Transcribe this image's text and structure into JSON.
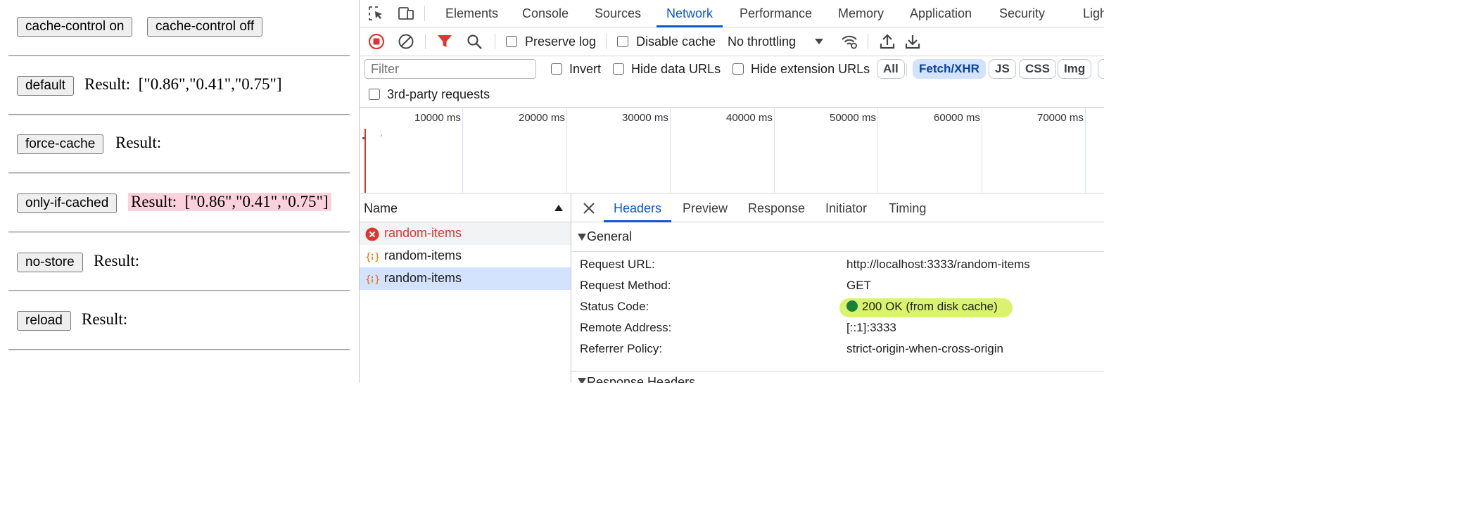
{
  "page": {
    "buttons": {
      "cache_on": "cache-control on",
      "cache_off": "cache-control off",
      "default": "default",
      "force_cache": "force-cache",
      "only_if_cached": "only-if-cached",
      "no_store": "no-store",
      "reload": "reload"
    },
    "result_label": "Result:",
    "results": {
      "default": "[\"0.86\",\"0.41\",\"0.75\"]",
      "force_cache": "",
      "only_if_cached": "[\"0.86\",\"0.41\",\"0.75\"]",
      "no_store": "",
      "reload": ""
    },
    "highlight_color": "#fbd1de"
  },
  "devtools": {
    "tabs": [
      "Elements",
      "Console",
      "Sources",
      "Network",
      "Performance",
      "Memory",
      "Application",
      "Security",
      "Ligh"
    ],
    "active_tab": "Network",
    "toolbar": {
      "preserve_log": "Preserve log",
      "disable_cache": "Disable cache",
      "throttling": "No throttling",
      "icons": [
        "record-stop-icon",
        "clear-icon",
        "filter-icon",
        "search-icon",
        "network-conditions-icon",
        "import-har-icon",
        "export-har-icon"
      ]
    },
    "filter": {
      "placeholder": "Filter",
      "invert": "Invert",
      "hide_data_urls": "Hide data URLs",
      "hide_extension_urls": "Hide extension URLs",
      "third_party": "3rd-party requests",
      "types": [
        "All",
        "Fetch/XHR",
        "JS",
        "CSS",
        "Img"
      ],
      "active_type": "Fetch/XHR"
    },
    "timeline": {
      "labels": [
        "10000 ms",
        "20000 ms",
        "30000 ms",
        "40000 ms",
        "50000 ms",
        "60000 ms",
        "70000 ms"
      ]
    },
    "requests": {
      "header": "Name",
      "rows": [
        {
          "name": "random-items",
          "status": "error"
        },
        {
          "name": "random-items",
          "status": "fetch"
        },
        {
          "name": "random-items",
          "status": "fetch",
          "selected": true
        }
      ]
    },
    "details": {
      "tabs": [
        "Headers",
        "Preview",
        "Response",
        "Initiator",
        "Timing"
      ],
      "active_tab": "Headers",
      "section": "General",
      "general": [
        {
          "key": "Request URL:",
          "value": "http://localhost:3333/random-items"
        },
        {
          "key": "Request Method:",
          "value": "GET"
        },
        {
          "key": "Status Code:",
          "value": "200 OK (from disk cache)"
        },
        {
          "key": "Remote Address:",
          "value": "[::1]:3333"
        },
        {
          "key": "Referrer Policy:",
          "value": "strict-origin-when-cross-origin"
        }
      ],
      "next_section": "Response Headers"
    },
    "accent": "#0b57d0",
    "status_ok_color": "#188038",
    "error_color": "#dc362e"
  }
}
